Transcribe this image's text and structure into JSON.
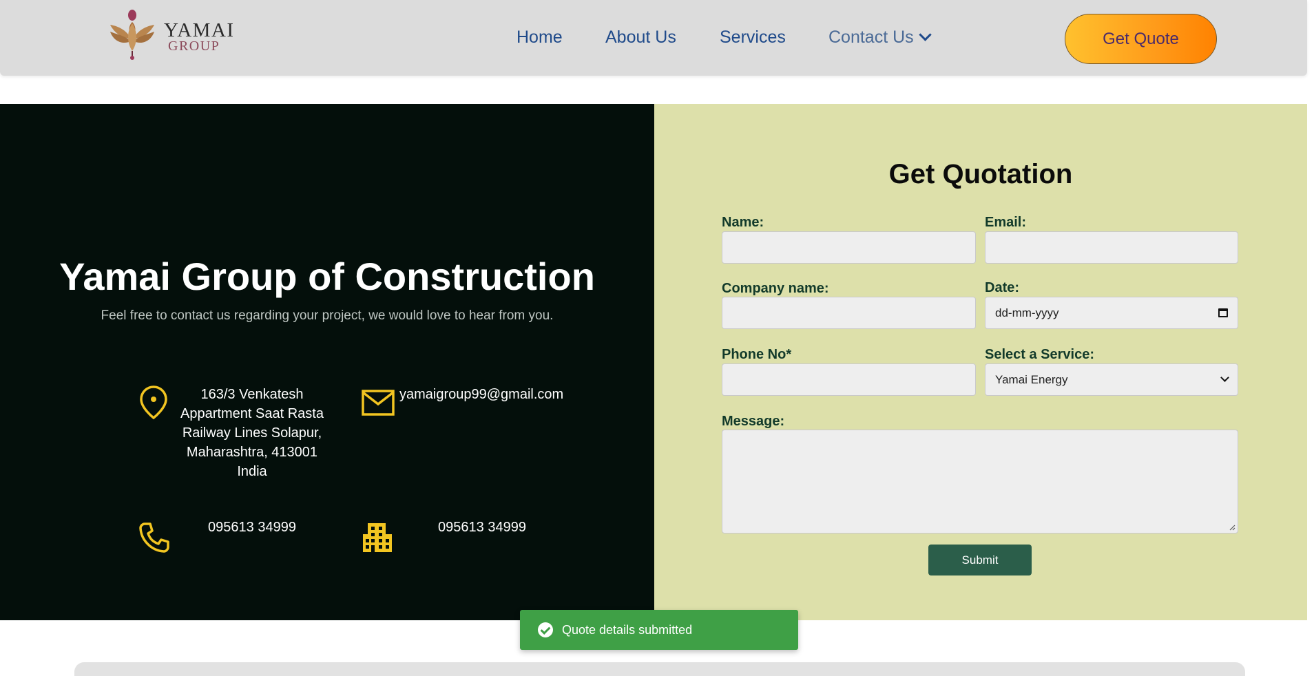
{
  "brand": {
    "name_line1": "YAMAI",
    "name_line2": "GROUP",
    "logo_icon": "lotus-icon"
  },
  "nav": {
    "items": [
      {
        "label": "Home"
      },
      {
        "label": "About Us"
      },
      {
        "label": "Services"
      },
      {
        "label": "Contact Us"
      }
    ],
    "cta_label": "Get Quote"
  },
  "hero": {
    "title": "Yamai Group of Construction",
    "subtitle": "Feel free to contact us regarding your project, we would love to hear from you."
  },
  "contact": {
    "address": [
      "163/3 Venkatesh",
      "Appartment Saat Rasta",
      "Railway Lines Solapur,",
      "Maharashtra, 413001",
      "India"
    ],
    "email": "yamaigroup99@gmail.com",
    "phone": "095613 34999",
    "office_phone": "095613 34999",
    "icons": [
      "location-pin-icon",
      "mail-icon",
      "phone-icon",
      "building-icon"
    ]
  },
  "form": {
    "title": "Get Quotation",
    "name_label": "Name:",
    "email_label": "Email:",
    "company_label": "Company name:",
    "date_label": "Date:",
    "date_placeholder": "dd-mm-yyyy",
    "phone_label": "Phone No*",
    "service_label": "Select a Service:",
    "service_selected": "Yamai Energy",
    "message_label": "Message:",
    "submit_label": "Submit"
  },
  "toast": {
    "message": "Quote details submitted"
  },
  "colors": {
    "header_bg": "#dcdcdc",
    "nav_text": "#1f4a8a",
    "left_panel_bg": "#040f0b",
    "right_panel_bg": "#dde0aa",
    "accent_yellow": "#f2c521",
    "submit_bg": "#2b5e4a",
    "toast_bg": "#3fa046"
  }
}
